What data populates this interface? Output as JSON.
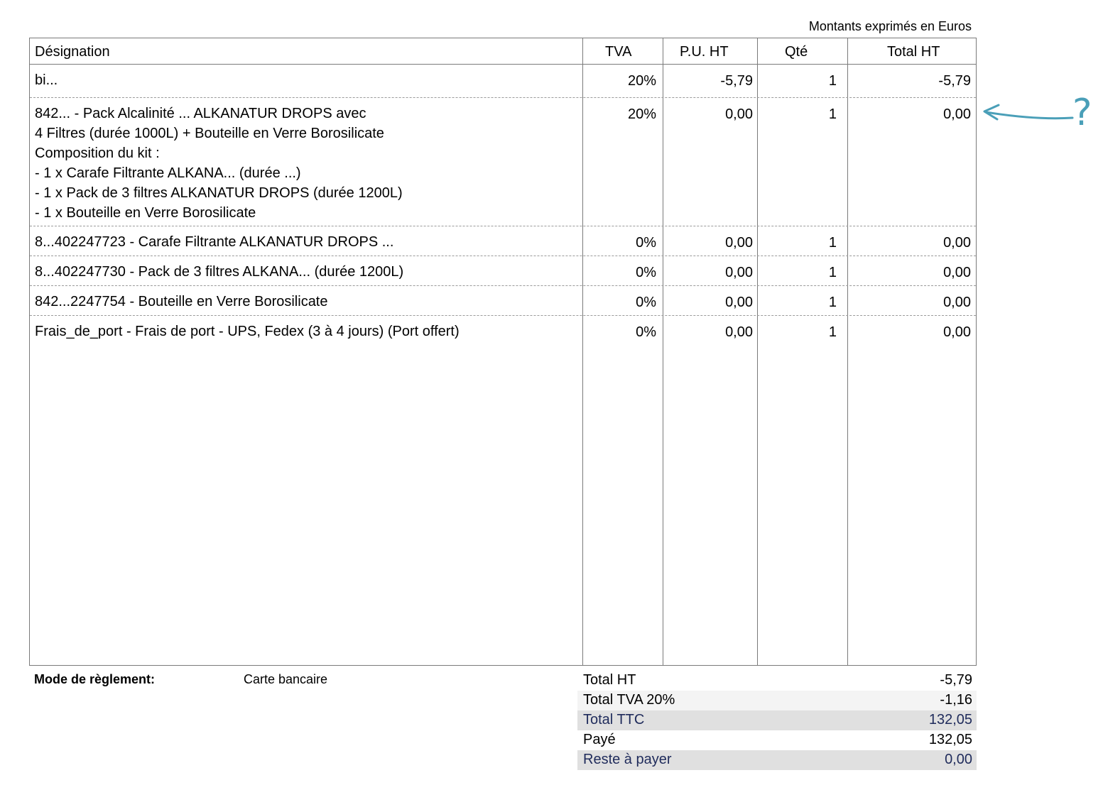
{
  "note": "Montants exprimés en Euros",
  "columns": {
    "designation": "Désignation",
    "tva": "TVA",
    "pu_ht": "P.U. HT",
    "qte": "Qté",
    "total_ht": "Total HT"
  },
  "rows": [
    {
      "lines": [
        "bi..."
      ],
      "tva": "20%",
      "pu": "-5,79",
      "qte": "1",
      "total": "-5,79"
    },
    {
      "lines": [
        "842... - Pack Alcalinité ... ALKANATUR DROPS avec",
        "4 Filtres (durée 1000L) + Bouteille en Verre Borosilicate",
        "Composition du kit :",
        " - 1 x Carafe Filtrante ALKANA... (durée ...)",
        " - 1 x Pack de 3 filtres ALKANATUR DROPS (durée 1200L)",
        " - 1 x Bouteille en Verre Borosilicate"
      ],
      "tva": "20%",
      "pu": "0,00",
      "qte": "1",
      "total": "0,00"
    },
    {
      "lines": [
        "8...402247723 - Carafe Filtrante ALKANATUR DROPS ..."
      ],
      "tva": "0%",
      "pu": "0,00",
      "qte": "1",
      "total": "0,00"
    },
    {
      "lines": [
        "8...402247730 - Pack de 3 filtres ALKANA... (durée 1200L)"
      ],
      "tva": "0%",
      "pu": "0,00",
      "qte": "1",
      "total": "0,00"
    },
    {
      "lines": [
        "842...2247754 - Bouteille en Verre Borosilicate"
      ],
      "tva": "0%",
      "pu": "0,00",
      "qte": "1",
      "total": "0,00"
    },
    {
      "lines": [
        "Frais_de_port - Frais de port - UPS, Fedex (3 à 4 jours) (Port offert)"
      ],
      "tva": "0%",
      "pu": "0,00",
      "qte": "1",
      "total": "0,00"
    }
  ],
  "payment": {
    "label": "Mode de règlement:",
    "value": "Carte bancaire"
  },
  "totals": [
    {
      "label": "Total HT",
      "value": "-5,79"
    },
    {
      "label": "Total TVA 20%",
      "value": "-1,16"
    },
    {
      "label": "Total TTC",
      "value": "132,05"
    },
    {
      "label": "Payé",
      "value": "132,05"
    },
    {
      "label": "Reste à payer",
      "value": "0,00"
    }
  ],
  "annotation": {
    "glyph": "?",
    "color": "#4a9fb8"
  }
}
